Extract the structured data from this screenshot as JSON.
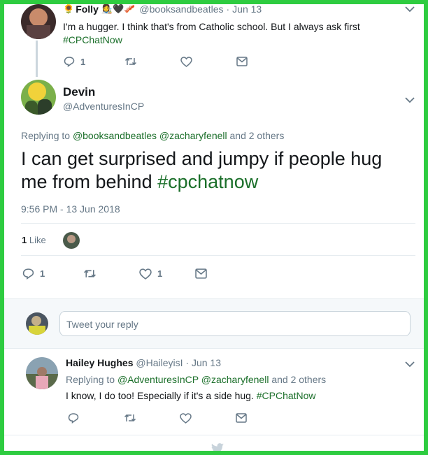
{
  "tweet1": {
    "name": "Folly",
    "handle": "@booksandbeatles",
    "date": "Jun 13",
    "text": "I'm a hugger. I think that's from Catholic school. But I always ask first",
    "hashtag": "#CPChatNow",
    "replies": "1"
  },
  "main": {
    "name": "Devin",
    "handle": "@AdventuresInCP",
    "replying_label": "Replying to",
    "replying_user1": "@booksandbeatles",
    "replying_user2": "@zacharyfenell",
    "replying_rest": "and 2 others",
    "text_line1": "I can get surprised and jumpy if people hug",
    "text_line2": "me from behind",
    "hashtag": "#cpchatnow",
    "timestamp": "9:56 PM - 13 Jun 2018",
    "likes_count": "1",
    "likes_label": "Like",
    "reply_count": "1",
    "heart_count": "1"
  },
  "compose": {
    "placeholder": "Tweet your reply"
  },
  "tweet3": {
    "name": "Hailey Hughes",
    "handle": "@HaileyisI",
    "date": "Jun 13",
    "replying_label": "Replying to",
    "replying_user1": "@AdventuresInCP",
    "replying_user2": "@zacharyfenell",
    "replying_rest": "and 2 others",
    "text": "I know, I do too! Especially if it's a side hug.",
    "hashtag": "#CPChatNow"
  },
  "colors": {
    "frame": "#2ecc40",
    "hashtag": "#1b6f2a",
    "muted": "#657786"
  }
}
